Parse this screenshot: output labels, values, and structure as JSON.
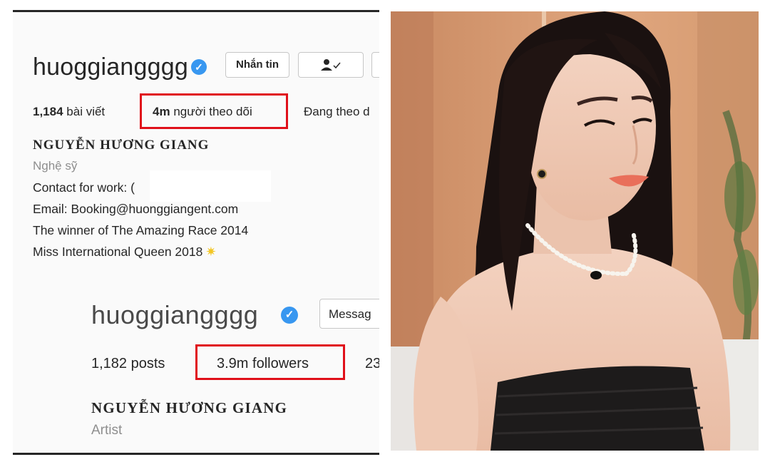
{
  "profile_new": {
    "username": "huoggiangggg",
    "message_button": "Nhắn tin",
    "posts_count": "1,184",
    "posts_label": "bài viết",
    "followers_count": "4m",
    "followers_label": "người theo dõi",
    "following_label": "Đang theo d",
    "full_name": "NGUYỄN HƯƠNG GIANG",
    "category": "Nghệ sỹ",
    "bio": [
      "Contact for work: (",
      "Email: Booking@huonggiangent.com",
      "The winner of The Amazing Race 2014",
      "Miss International Queen 2018"
    ]
  },
  "profile_old": {
    "username": "huoggiangggg",
    "message_button": "Messag",
    "posts_count": "1,182",
    "posts_label": "posts",
    "followers_count": "3.9m",
    "followers_label": "followers",
    "following_count": "23",
    "full_name": "NGUYỄN HƯƠNG GIANG",
    "category": "Artist"
  },
  "colors": {
    "highlight_box": "#e0101a",
    "verified_badge": "#3897f0",
    "muted_text": "#8e8e8e"
  },
  "icons": [
    "verified-badge-icon",
    "follow-check-icon",
    "sparkle-star-icon"
  ]
}
